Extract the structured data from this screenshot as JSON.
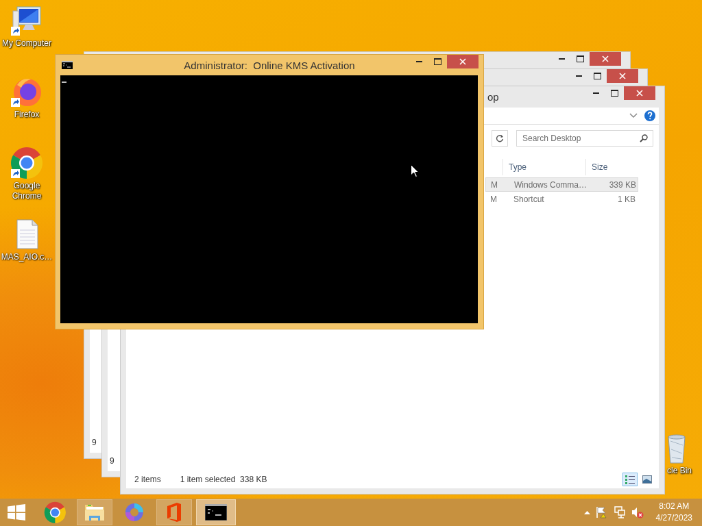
{
  "desktop_icons": [
    {
      "label": "My Computer",
      "kind": "computer"
    },
    {
      "label": "Firefox",
      "kind": "firefox"
    },
    {
      "label": "Google Chrome",
      "kind": "chrome"
    },
    {
      "label": "MAS_AIO.c…",
      "kind": "file"
    },
    {
      "label": "cle Bin",
      "kind": "recycle"
    }
  ],
  "background_windows": [
    {
      "fragment": "9"
    },
    {
      "fragment": "9"
    }
  ],
  "explorer": {
    "title": "op",
    "search": {
      "placeholder": "Search Desktop"
    },
    "columns": [
      "Type",
      "Size"
    ],
    "rows": [
      {
        "column_1": "M",
        "type": "Windows Comma…",
        "size": "339 KB",
        "selected": true
      },
      {
        "column_1": "M",
        "type": "Shortcut",
        "size": "1 KB",
        "selected": false
      }
    ],
    "status": {
      "count": "2 items",
      "selection": "1 item selected  338 KB"
    },
    "views": [
      {
        "kind": "details",
        "selected": true
      },
      {
        "kind": "tiles",
        "selected": false
      }
    ]
  },
  "console": {
    "title": "Administrator:  Online KMS Activation"
  },
  "taskbar": {
    "apps": [
      {
        "kind": "start",
        "running": false,
        "active": false
      },
      {
        "kind": "chrome",
        "running": false,
        "active": false
      },
      {
        "kind": "explorer",
        "running": true,
        "active": false
      },
      {
        "kind": "copilot",
        "running": false,
        "active": false
      },
      {
        "kind": "office",
        "running": true,
        "active": false
      },
      {
        "kind": "console",
        "running": true,
        "active": true
      }
    ],
    "tray": [
      {
        "kind": "caret"
      },
      {
        "kind": "flag"
      },
      {
        "kind": "network"
      },
      {
        "kind": "speaker-muted"
      }
    ],
    "clock": {
      "time": "8:02 AM",
      "date": "4/27/2023"
    }
  }
}
